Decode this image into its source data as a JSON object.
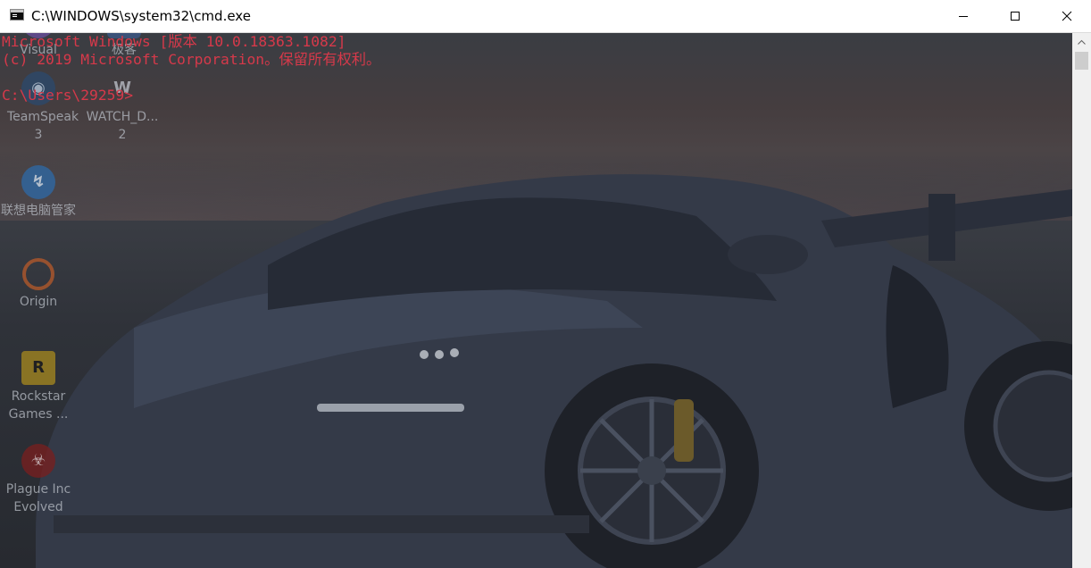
{
  "window": {
    "title": "C:\\WINDOWS\\system32\\cmd.exe",
    "icon": "console-icon",
    "controls": {
      "minimize": "minimize-icon",
      "maximize": "maximize-icon",
      "close": "close-icon"
    }
  },
  "console": {
    "lines": [
      "Microsoft Windows [版本 10.0.18363.1082]",
      "(c) 2019 Microsoft Corporation。保留所有权利。",
      "",
      "C:\\Users\\29259>"
    ],
    "text_color": "#d6394a"
  },
  "desktop_icons": [
    {
      "label": "Visual",
      "icon": "visual-studio-icon"
    },
    {
      "label": "极客",
      "icon": "geek-icon"
    },
    {
      "label": "TeamSpeak 3",
      "icon": "teamspeak-icon"
    },
    {
      "label": "WATCH_D... 2",
      "icon": "watch-dogs-icon"
    },
    {
      "label": "联想电脑管家",
      "icon": "lenovo-manager-icon"
    },
    {
      "label": "Origin",
      "icon": "origin-icon"
    },
    {
      "label": "Rockstar Games ...",
      "icon": "rockstar-icon"
    },
    {
      "label": "Plague Inc Evolved",
      "icon": "plague-inc-icon"
    }
  ],
  "scrollbar": {
    "up_arrow": "scroll-up-arrow-icon"
  }
}
